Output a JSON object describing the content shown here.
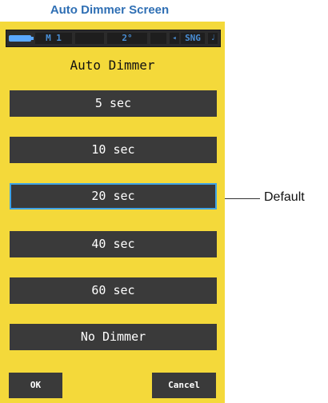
{
  "caption": "Auto Dimmer Screen",
  "status_bar": {
    "mode": "M 1",
    "angle": "2°",
    "shot": "SNG",
    "icons": [
      "battery-icon",
      "memory-icon",
      "note-icon"
    ]
  },
  "title": "Auto Dimmer",
  "options": [
    {
      "label": "5 sec",
      "selected": false
    },
    {
      "label": "10 sec",
      "selected": false
    },
    {
      "label": "20 sec",
      "selected": true
    },
    {
      "label": "40 sec",
      "selected": false
    },
    {
      "label": "60 sec",
      "selected": false
    },
    {
      "label": "No Dimmer",
      "selected": false
    }
  ],
  "buttons": {
    "ok": "OK",
    "cancel": "Cancel"
  },
  "annotation": {
    "default_label": "Default"
  },
  "colors": {
    "body": "#f4d93a",
    "button": "#3a3a3a",
    "selected_border": "#3fa3e6",
    "caption": "#2f6fb4"
  }
}
